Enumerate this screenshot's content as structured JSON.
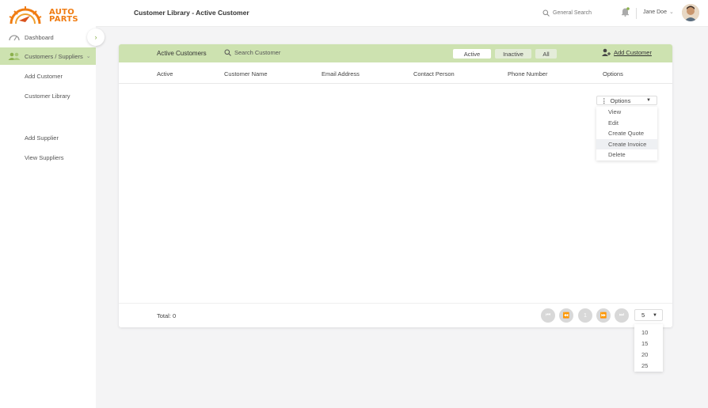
{
  "brand": {
    "line1": "AUTO",
    "line2": "PARTS",
    "color": "#f07c12"
  },
  "sidebar": {
    "items": [
      {
        "label": "Dashboard",
        "icon": "gauge-icon"
      },
      {
        "label": "Customers / Suppliers",
        "icon": "users-icon",
        "active": true
      }
    ],
    "subitems": [
      "Add Customer",
      "Customer Library",
      "Add Supplier",
      "View Suppliers"
    ]
  },
  "header": {
    "title": "Customer Library - Active Customer",
    "search_placeholder": "General Search",
    "user_name": "Jane Doe"
  },
  "toolbar": {
    "title": "Active Customers",
    "search_placeholder": "Search Customer",
    "segments": [
      "Active",
      "Inactive",
      "All"
    ],
    "selected_segment": "Active",
    "add_label": "Add Customer"
  },
  "table": {
    "columns": [
      "Active",
      "Customer Name",
      "Email Address",
      "Contact Person",
      "Phone Number",
      "Options"
    ]
  },
  "options": {
    "label": "Options",
    "items": [
      "View",
      "Edit",
      "Create Quote",
      "Create Invoice",
      "Delete"
    ],
    "highlighted": "Create Invoice"
  },
  "footer": {
    "total": "Total: 0",
    "current_page": "1",
    "page_size": "5",
    "page_size_options": [
      "10",
      "15",
      "20",
      "25"
    ]
  },
  "colors": {
    "accent": "#cde2b0",
    "accent_dark": "#8bb04c"
  }
}
